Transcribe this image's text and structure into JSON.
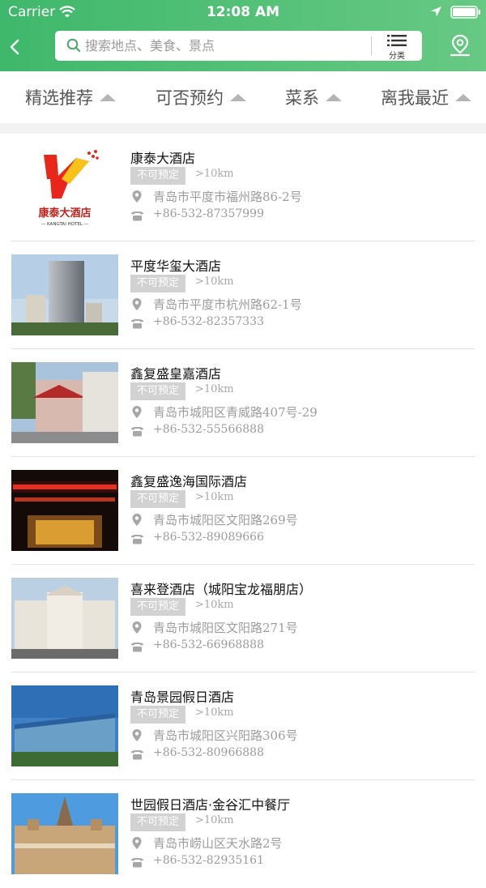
{
  "status_bar": {
    "carrier": "Carrier",
    "time": "12:08 AM"
  },
  "header": {
    "search_placeholder": "搜索地点、美食、景点",
    "category_label": "分类",
    "back_icon": "chevron-left-icon",
    "map_icon": "map-pin-icon"
  },
  "filters": [
    {
      "label": "精选推荐"
    },
    {
      "label": "可否预约"
    },
    {
      "label": "菜系"
    },
    {
      "label": "离我最近"
    }
  ],
  "colors": {
    "header_start": "#3fb86b",
    "header_end": "#67c983",
    "badge": "#d2d2d2"
  },
  "restaurants": [
    {
      "name": "康泰大酒店",
      "status": "不可预定",
      "distance": ">10km",
      "address": "青岛市平度市福州路86-2号",
      "phone": "+86-532-87357999",
      "logo": {
        "title": "康泰大酒店",
        "subtitle": "— KANGTAI HOTEL —"
      }
    },
    {
      "name": "平度华玺大酒店",
      "status": "不可预定",
      "distance": ">10km",
      "address": "青岛市平度市杭州路62-1号",
      "phone": "+86-532-82357333"
    },
    {
      "name": "鑫复盛皇嘉酒店",
      "status": "不可预定",
      "distance": ">10km",
      "address": "青岛市城阳区青威路407号-29",
      "phone": "+86-532-55566888"
    },
    {
      "name": "鑫复盛逸海国际酒店",
      "status": "不可预定",
      "distance": ">10km",
      "address": "青岛市城阳区文阳路269号",
      "phone": "+86-532-89089666"
    },
    {
      "name": "喜来登酒店（城阳宝龙福朋店）",
      "status": "不可预定",
      "distance": ">10km",
      "address": "青岛市城阳区文阳路271号",
      "phone": "+86-532-66968888"
    },
    {
      "name": "青岛景园假日酒店",
      "status": "不可预定",
      "distance": ">10km",
      "address": "青岛市城阳区兴阳路306号",
      "phone": "+86-532-80966888"
    },
    {
      "name": "世园假日酒店·金谷汇中餐厅",
      "status": "不可预定",
      "distance": ">10km",
      "address": "青岛市崂山区天水路2号",
      "phone": "+86-532-82935161"
    }
  ]
}
